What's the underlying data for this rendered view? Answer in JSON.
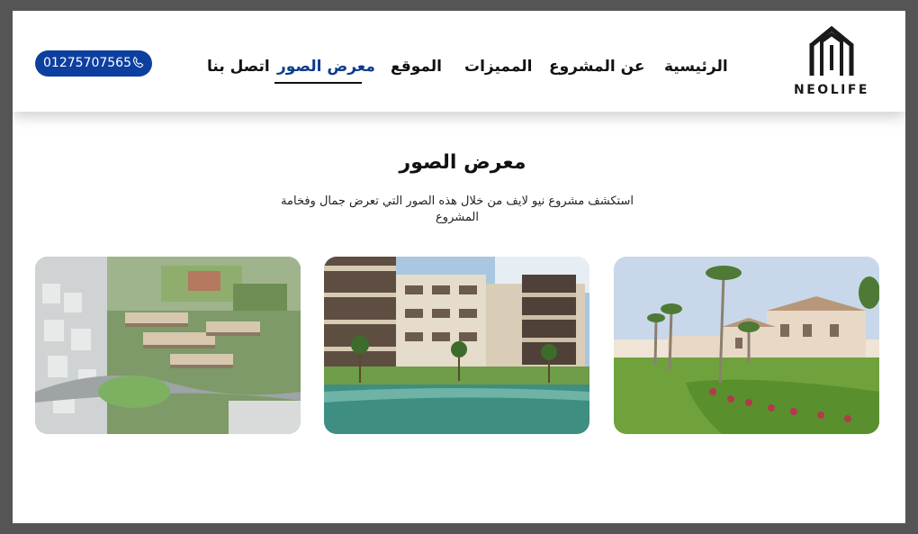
{
  "brand": {
    "name": "NEOLIFE"
  },
  "nav": {
    "items": [
      {
        "label": "الرئيسية"
      },
      {
        "label": "عن المشروع"
      },
      {
        "label": "المميزات"
      },
      {
        "label": "الموقع"
      },
      {
        "label": "معرض الصور",
        "active": true
      },
      {
        "label": "اتصل بنا"
      }
    ],
    "phone": {
      "number": "01275707565",
      "icon": "phone-icon"
    }
  },
  "gallery": {
    "title": "معرض الصور",
    "description": "استكشف مشروع نيو لايف من خلال هذه الصور التي تعرض جمال وفخامة المشروع",
    "images": [
      {
        "name": "villas-with-palm-trees-photo"
      },
      {
        "name": "apartment-buildings-with-lake-photo"
      },
      {
        "name": "aerial-compound-view-photo"
      }
    ]
  },
  "colors": {
    "accent": "#0c3fa0",
    "active_nav": "#0c3d8c",
    "text": "#111111"
  }
}
